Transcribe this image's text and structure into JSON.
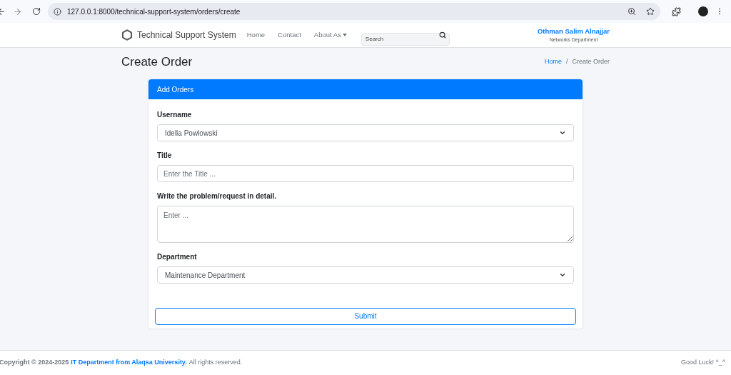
{
  "browser": {
    "url": "127.0.0.1:8000/technical-support-system/orders/create"
  },
  "navbar": {
    "brand": "Technical Support System",
    "links": [
      {
        "label": "Home",
        "kind": "link"
      },
      {
        "label": "Contact",
        "kind": "link"
      },
      {
        "label": "About As",
        "kind": "dropdown"
      }
    ],
    "search": {
      "placeholder": "Search"
    },
    "user": {
      "name": "Othman Salim Alnajjar",
      "department": "Networks Department"
    }
  },
  "page": {
    "title": "Create Order",
    "breadcrumb_separator": "/",
    "breadcrumb": [
      {
        "label": "Home",
        "selected": false
      },
      {
        "label": "Create Order",
        "selected": true
      }
    ]
  },
  "card": {
    "title": "Add Orders",
    "fields": [
      {
        "label": "Username",
        "kind": "select",
        "value": "Idella Powlowski"
      },
      {
        "label": "Title",
        "kind": "input",
        "placeholder": "Enter the Title ..."
      },
      {
        "label": "Write the problem/request in detail.",
        "kind": "textarea",
        "placeholder": "Enter ..."
      },
      {
        "label": "Department",
        "kind": "select",
        "value": "Maintenance Department"
      }
    ],
    "submit": "Submit"
  },
  "footer": {
    "prefix": "Copyright © 2024-2025",
    "link": "IT Department from Alaqsa University.",
    "suffix": "All rights reserved.",
    "right": "Good Luck! ^_^"
  }
}
